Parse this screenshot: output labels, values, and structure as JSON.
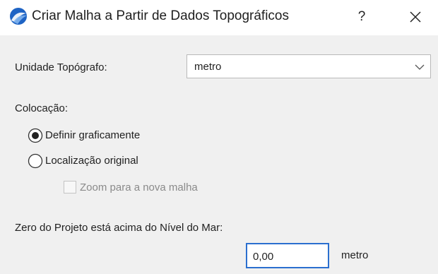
{
  "window": {
    "title": "Criar Malha a Partir de Dados Topográficos",
    "help_label": "?",
    "icon": "archicad-app-icon",
    "close_icon": "close-icon"
  },
  "form": {
    "unit_label": "Unidade Topógrafo:",
    "unit_value": "metro",
    "placement_label": "Colocação:",
    "placement_options": [
      {
        "label": "Definir graficamente",
        "selected": true
      },
      {
        "label": "Localização original",
        "selected": false
      }
    ],
    "zoom_checkbox": {
      "label": "Zoom para a nova malha",
      "checked": false,
      "enabled": false
    },
    "sea_level_label": "Zero do Projeto está acima do Nível do Mar:",
    "sea_level_value": "0,00",
    "sea_level_unit": "metro"
  },
  "colors": {
    "accent_border": "#2b6fcf",
    "dialog_bg": "#f0f0f0",
    "titlebar_bg": "#ffffff"
  }
}
